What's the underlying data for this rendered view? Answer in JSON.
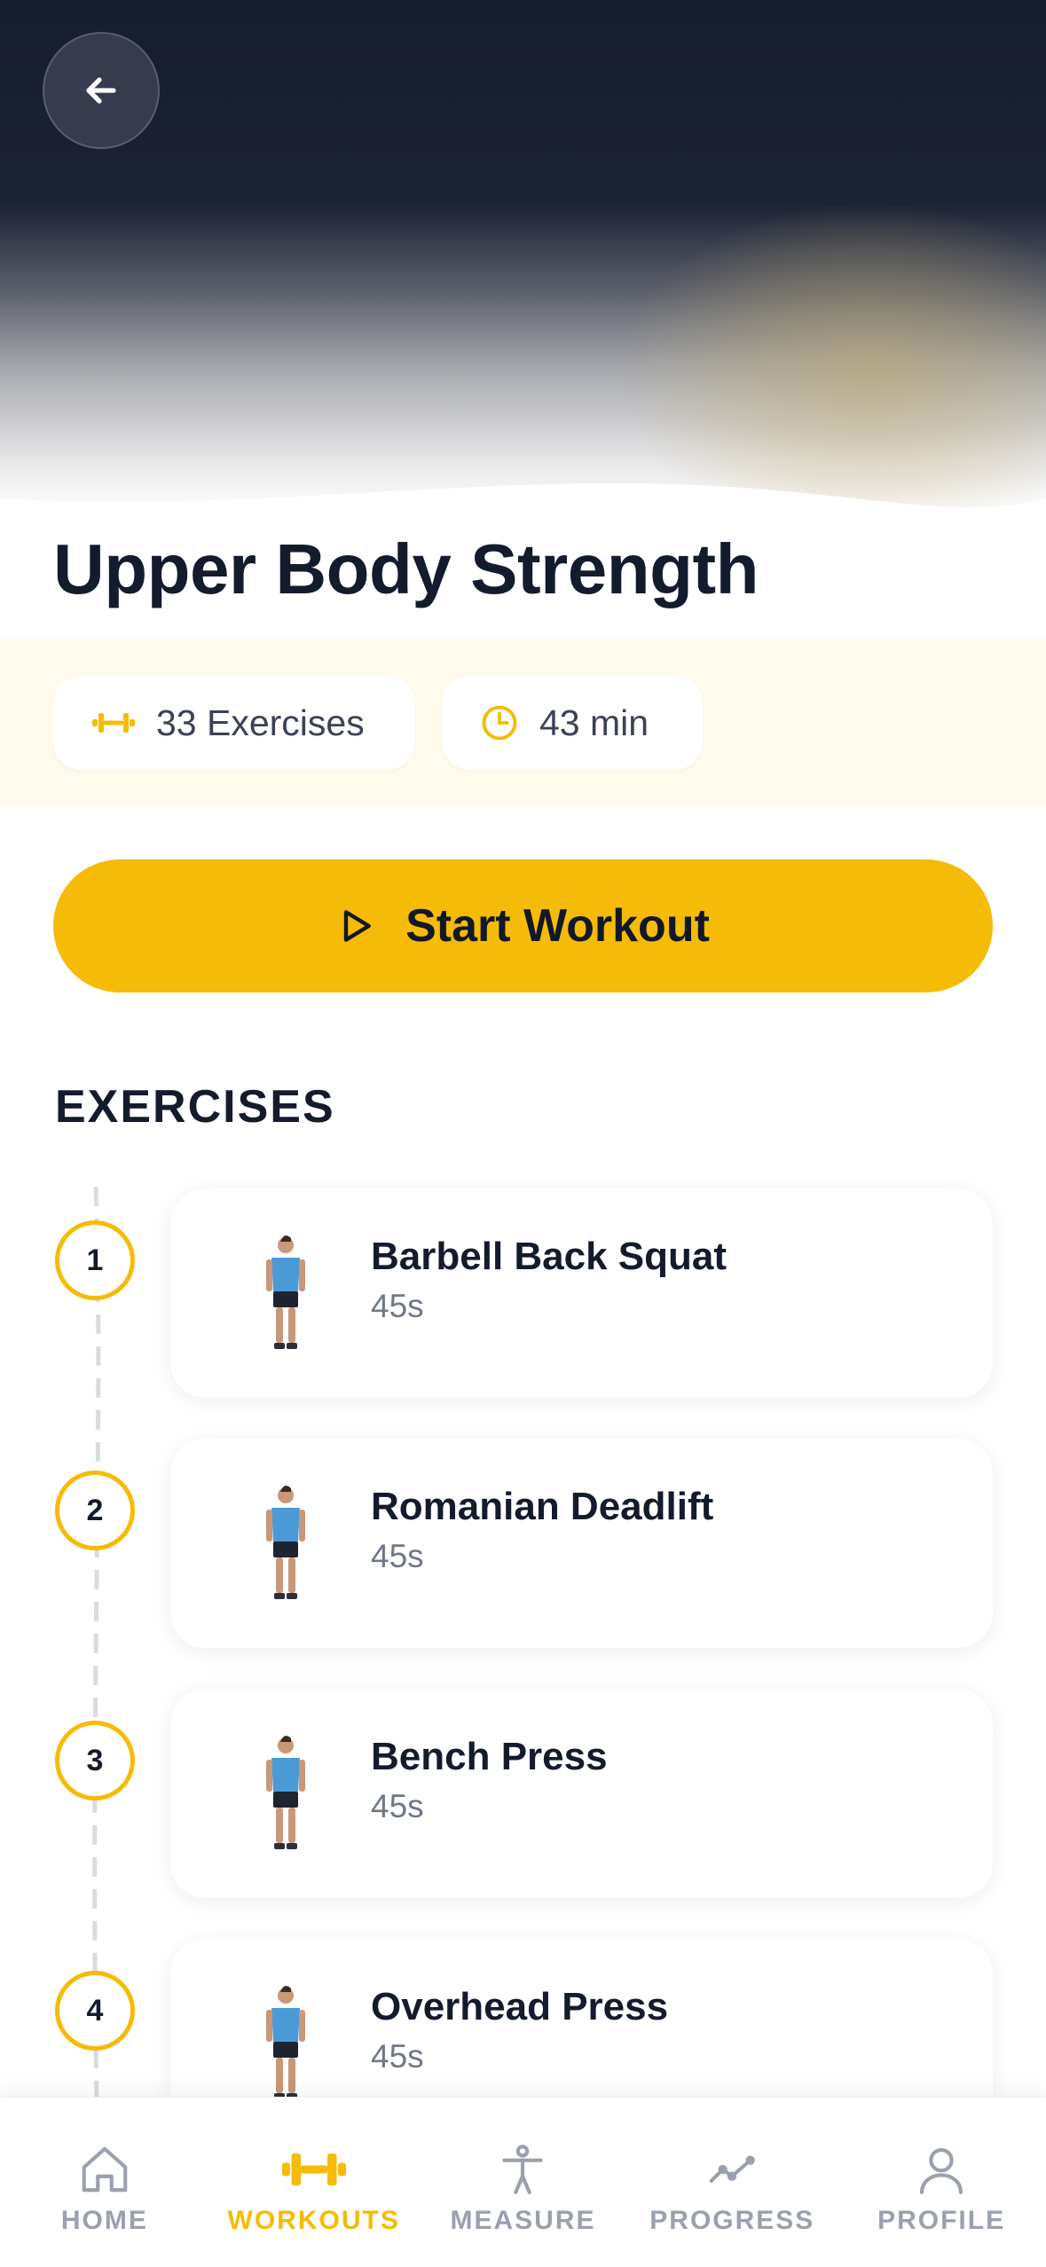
{
  "workout": {
    "title": "Upper Body Strength",
    "exercise_count_label": "33 Exercises",
    "duration_label": "43 min",
    "start_label": "Start Workout"
  },
  "section": {
    "title": "EXERCISES"
  },
  "exercises": [
    {
      "number": "1",
      "name": "Barbell Back Squat",
      "duration": "45s"
    },
    {
      "number": "2",
      "name": "Romanian Deadlift",
      "duration": "45s"
    },
    {
      "number": "3",
      "name": "Bench Press",
      "duration": "45s"
    },
    {
      "number": "4",
      "name": "Overhead Press",
      "duration": "45s"
    }
  ],
  "tabs": [
    {
      "label": "HOME",
      "icon": "home-icon"
    },
    {
      "label": "WORKOUTS",
      "icon": "dumbbell-icon",
      "active": true
    },
    {
      "label": "MEASURE",
      "icon": "body-icon"
    },
    {
      "label": "PROGRESS",
      "icon": "trend-icon"
    },
    {
      "label": "PROFILE",
      "icon": "user-icon"
    }
  ],
  "icons": {
    "back": "arrow-left-icon",
    "exercises_chip": "dumbbell-icon",
    "duration_chip": "clock-icon",
    "start": "play-icon"
  },
  "colors": {
    "accent": "#f5bb06",
    "text_primary": "#141b2d",
    "text_secondary": "#707788",
    "tab_inactive": "#9aa0ad",
    "stats_band": "#fefbec",
    "hero_dark": "#161d2e"
  }
}
